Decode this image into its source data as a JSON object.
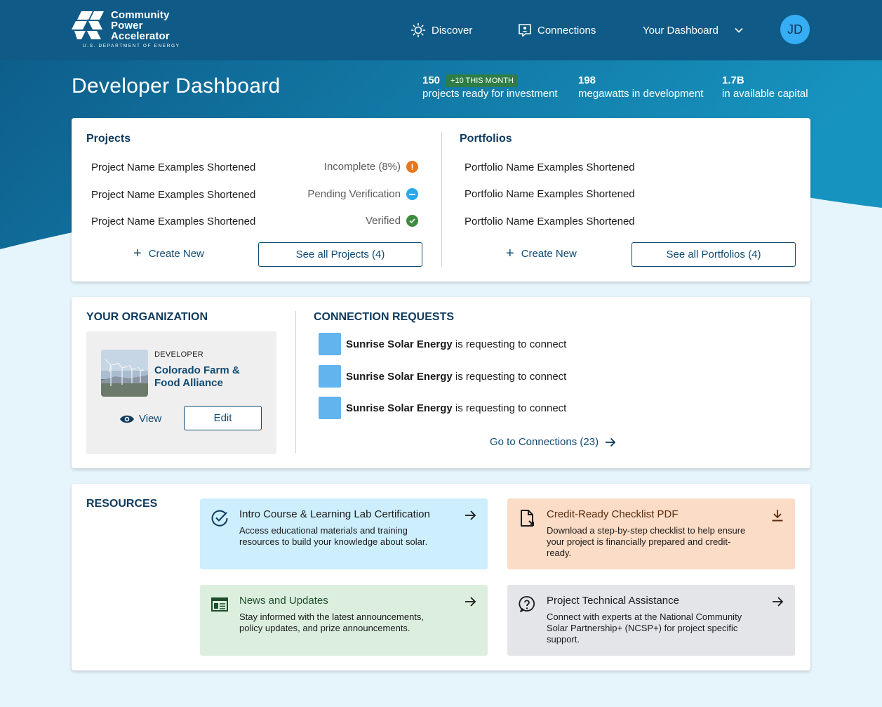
{
  "nav": {
    "logo_lines": [
      "Community",
      "Power",
      "Accelerator"
    ],
    "logo_sub": "U.S. DEPARTMENT OF ENERGY",
    "items": [
      {
        "label": "Discover",
        "icon": "sun-icon"
      },
      {
        "label": "Connections",
        "icon": "connections-icon"
      },
      {
        "label": "Your Dashboard",
        "icon": "chevron-down-icon"
      }
    ],
    "avatar_initials": "JD"
  },
  "header": {
    "title": "Developer Dashboard",
    "stats": [
      {
        "value": "150",
        "badge": "+10 THIS MONTH",
        "label": "projects ready for investment"
      },
      {
        "value": "198",
        "label": "megawatts in development"
      },
      {
        "value": "1.7B",
        "label": "in available capital"
      }
    ]
  },
  "projects": {
    "heading": "Projects",
    "items": [
      {
        "name": "Project Name Examples Shortened",
        "status": "Incomplete (8%)",
        "status_icon": "alert-icon",
        "status_color": "#e8751a"
      },
      {
        "name": "Project Name Examples Shortened",
        "status": "Pending Verification",
        "status_icon": "pending-icon",
        "status_color": "#2aa8e8"
      },
      {
        "name": "Project Name Examples Shortened",
        "status": "Verified",
        "status_icon": "check-circle-icon",
        "status_color": "#3d8b3d"
      }
    ],
    "create_label": "Create New",
    "see_all_label": "See all Projects (4)"
  },
  "portfolios": {
    "heading": "Portfolios",
    "items": [
      {
        "name": "Portfolio Name Examples Shortened"
      },
      {
        "name": "Portfolio Name Examples Shortened"
      },
      {
        "name": "Portfolio Name Examples Shortened"
      }
    ],
    "create_label": "Create New",
    "see_all_label": "See all Portfolios (4)"
  },
  "organization": {
    "heading": "YOUR ORGANIZATION",
    "role": "DEVELOPER",
    "name": "Colorado Farm & Food Alliance",
    "view_label": "View",
    "edit_label": "Edit"
  },
  "connections": {
    "heading": "CONNECTION REQUESTS",
    "requests": [
      {
        "org": "Sunrise Solar Energy",
        "text": " is requesting to connect"
      },
      {
        "org": "Sunrise Solar Energy",
        "text": " is requesting to connect"
      },
      {
        "org": "Sunrise Solar Energy",
        "text": " is requesting to connect"
      }
    ],
    "go_label": "Go to Connections (23)"
  },
  "resources": {
    "heading": "RESOURCES",
    "tiles": [
      {
        "title": "Intro Course & Learning Lab Certification",
        "desc": "Access educational materials and training resources to build your knowledge about solar.",
        "icon": "check-circle-icon",
        "action_icon": "arrow-right-icon",
        "color": "#cdeefc"
      },
      {
        "title": "Credit-Ready Checklist PDF",
        "desc": "Download a step-by-step checklist to help ensure your project is financially prepared and credit-ready.",
        "icon": "document-icon",
        "action_icon": "download-icon",
        "color": "#fbdcc6"
      },
      {
        "title": "News and Updates",
        "desc": "Stay informed with the latest announcements, policy updates, and prize announcements.",
        "icon": "newspaper-icon",
        "action_icon": "arrow-right-icon",
        "color": "#dcefdf"
      },
      {
        "title": "Project Technical Assistance",
        "desc": "Connect with experts at the  National Community Solar Partnership+ (NCSP+) for project specific support.",
        "icon": "help-icon",
        "action_icon": "arrow-right-icon",
        "color": "#e3e5e8"
      }
    ]
  }
}
